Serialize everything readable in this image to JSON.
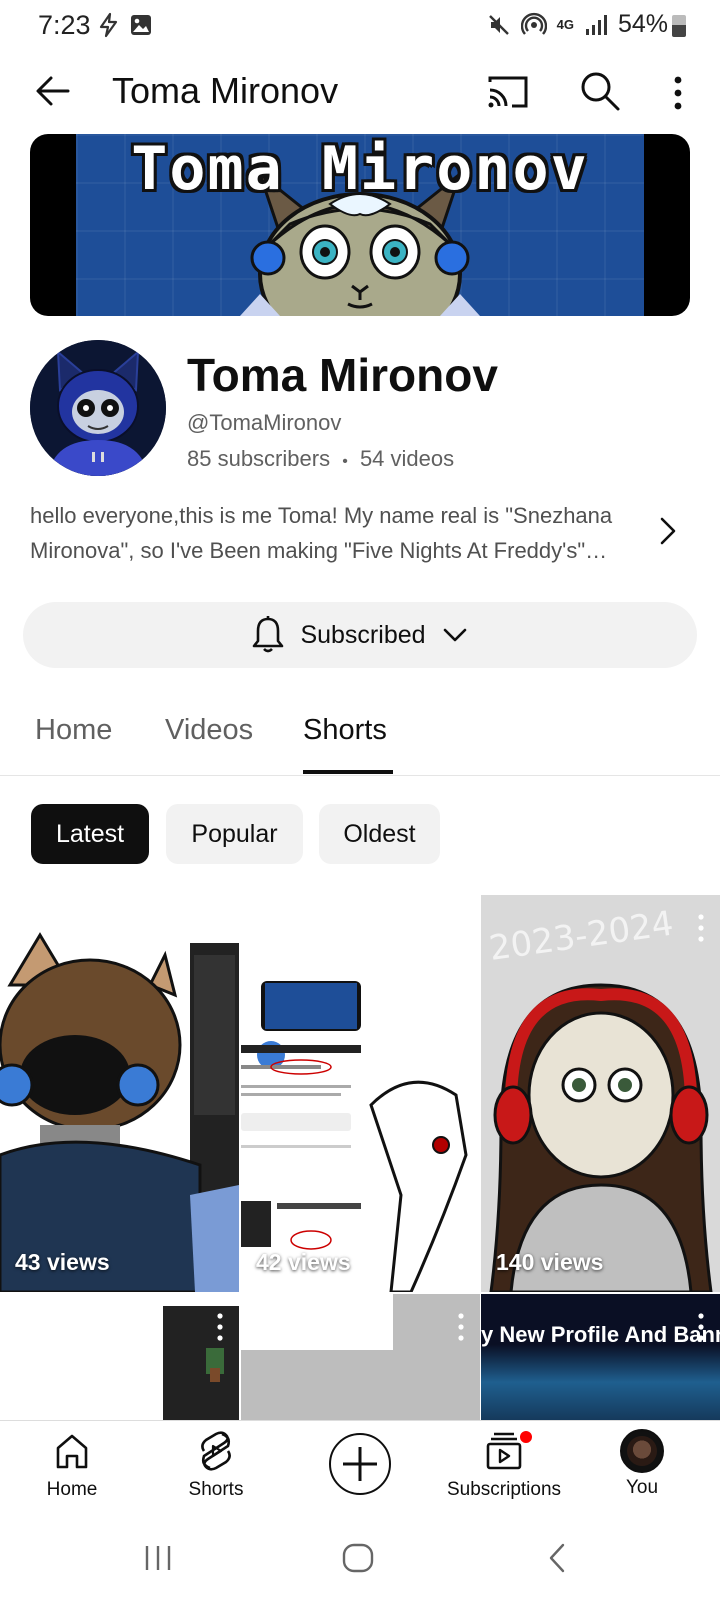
{
  "status_bar": {
    "time": "7:23",
    "battery": "54%",
    "network": "4G"
  },
  "app_bar": {
    "title": "Toma Mironov"
  },
  "banner": {
    "text": "Toma Mironov"
  },
  "channel": {
    "name": "Toma Mironov",
    "handle": "@TomaMironov",
    "subscribers": "85 subscribers",
    "separator": "•",
    "videos": "54 videos",
    "description": "hello everyone,this is me Toma! My name real is \"Snezhana Mironova\", so I've Been making \"Five Nights At Freddy's\" animations and more!"
  },
  "subscribe": {
    "label": "Subscribed"
  },
  "tabs": [
    {
      "label": "Home",
      "active": false
    },
    {
      "label": "Videos",
      "active": false
    },
    {
      "label": "Shorts",
      "active": true
    }
  ],
  "chips": [
    {
      "label": "Latest",
      "selected": true
    },
    {
      "label": "Popular",
      "selected": false
    },
    {
      "label": "Oldest",
      "selected": false
    }
  ],
  "shorts": [
    {
      "views": "43 views"
    },
    {
      "views": "42 views"
    },
    {
      "views": "140 views"
    },
    {
      "views": ""
    },
    {
      "views": ""
    },
    {
      "views": "",
      "title": "y New Profile And Banner"
    }
  ],
  "bottom_nav": [
    {
      "label": "Home",
      "icon": "home-icon"
    },
    {
      "label": "Shorts",
      "icon": "shorts-icon"
    },
    {
      "label": "",
      "icon": "plus-icon"
    },
    {
      "label": "Subscriptions",
      "icon": "subscriptions-icon",
      "has_notification": true
    },
    {
      "label": "You",
      "icon": "avatar"
    }
  ],
  "colors": {
    "accent": "#0f0f0f",
    "notification": "#ff0000",
    "banner_bg": "#1e4e98"
  }
}
